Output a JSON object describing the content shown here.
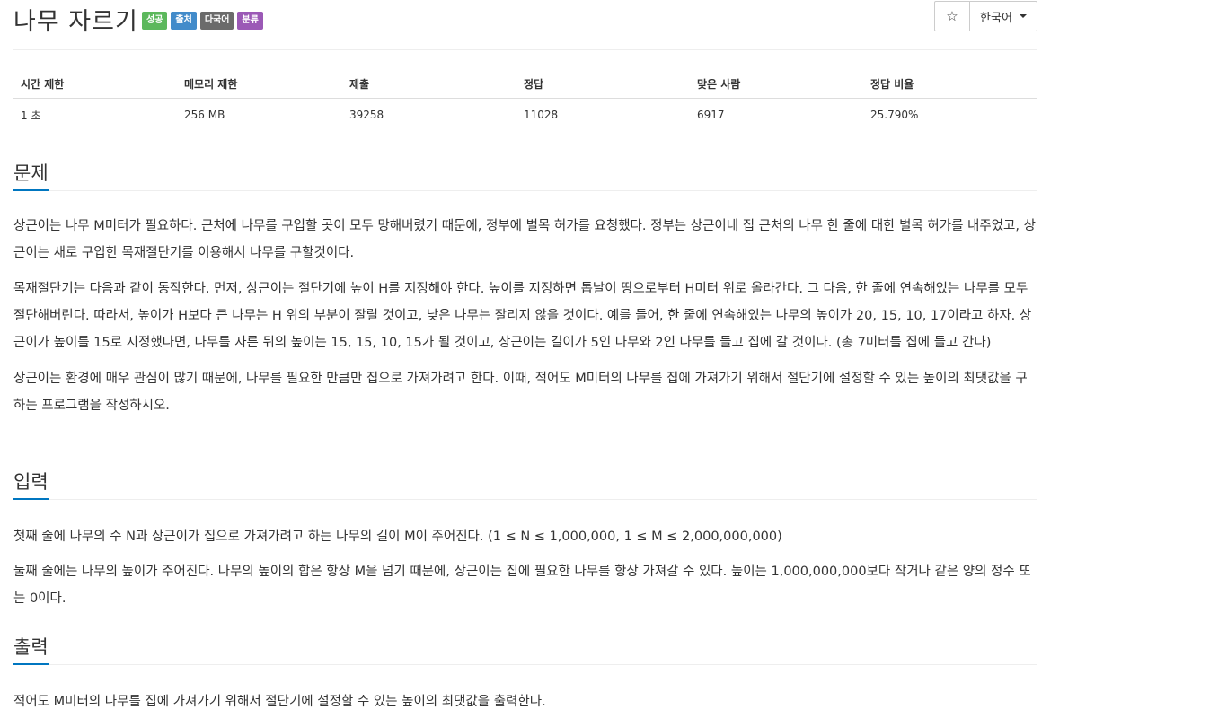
{
  "header": {
    "title": "나무 자르기",
    "badges": [
      "성공",
      "출처",
      "다국어",
      "분류"
    ],
    "star_glyph": "☆",
    "language": "한국어"
  },
  "info_table": {
    "headers": [
      "시간 제한",
      "메모리 제한",
      "제출",
      "정답",
      "맞은 사람",
      "정답 비율"
    ],
    "values": [
      "1 초",
      "256 MB",
      "39258",
      "11028",
      "6917",
      "25.790%"
    ]
  },
  "problem": {
    "title": "문제",
    "paragraphs": [
      "상근이는 나무 M미터가 필요하다. 근처에 나무를 구입할 곳이 모두 망해버렸기 때문에, 정부에 벌목 허가를 요청했다. 정부는 상근이네 집 근처의 나무 한 줄에 대한 벌목 허가를 내주었고, 상근이는 새로 구입한 목재절단기를 이용해서 나무를 구할것이다.",
      "목재절단기는 다음과 같이 동작한다. 먼저, 상근이는 절단기에 높이 H를 지정해야 한다. 높이를 지정하면 톱날이 땅으로부터 H미터 위로 올라간다. 그 다음, 한 줄에 연속해있는 나무를 모두 절단해버린다. 따라서, 높이가 H보다 큰 나무는 H 위의 부분이 잘릴 것이고, 낮은 나무는 잘리지 않을 것이다. 예를 들어, 한 줄에 연속해있는 나무의 높이가 20, 15, 10, 17이라고 하자. 상근이가 높이를 15로 지정했다면, 나무를 자른 뒤의 높이는 15, 15, 10, 15가 될 것이고, 상근이는 길이가 5인 나무와 2인 나무를 들고 집에 갈 것이다. (총 7미터를 집에 들고 간다)",
      "상근이는 환경에 매우 관심이 많기 때문에, 나무를 필요한 만큼만 집으로 가져가려고 한다. 이때, 적어도 M미터의 나무를 집에 가져가기 위해서 절단기에 설정할 수 있는 높이의 최댓값을 구하는 프로그램을 작성하시오."
    ]
  },
  "input": {
    "title": "입력",
    "paragraphs": [
      "첫째 줄에 나무의 수 N과 상근이가 집으로 가져가려고 하는 나무의 길이 M이 주어진다. (1 ≤ N ≤ 1,000,000, 1 ≤ M ≤ 2,000,000,000)",
      "둘째 줄에는 나무의 높이가 주어진다. 나무의 높이의 합은 항상 M을 넘기 때문에, 상근이는 집에 필요한 나무를 항상 가져갈 수 있다. 높이는 1,000,000,000보다 작거나 같은 양의 정수 또는 0이다."
    ]
  },
  "output": {
    "title": "출력",
    "paragraphs": [
      "적어도 M미터의 나무를 집에 가져가기 위해서 절단기에 설정할 수 있는 높이의 최댓값을 출력한다."
    ]
  }
}
